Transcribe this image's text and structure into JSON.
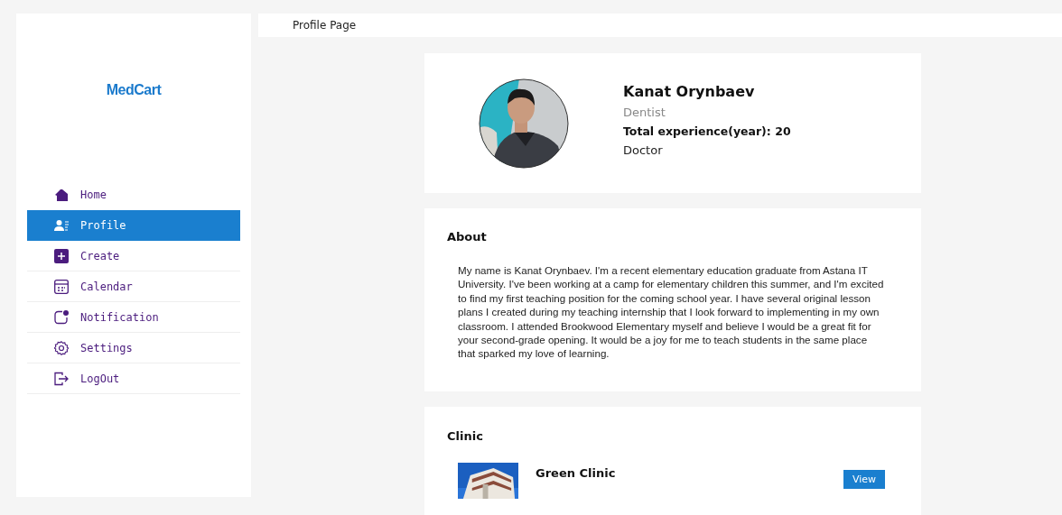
{
  "sidebar": {
    "logo": "MedCart",
    "items": [
      {
        "label": "Home",
        "selected": false
      },
      {
        "label": "Profile",
        "selected": true
      },
      {
        "label": "Create",
        "selected": false
      },
      {
        "label": "Calendar",
        "selected": false
      },
      {
        "label": "Notification",
        "selected": false
      },
      {
        "label": "Settings",
        "selected": false
      },
      {
        "label": "LogOut",
        "selected": false
      }
    ]
  },
  "header": {
    "title": "Profile Page"
  },
  "profile": {
    "name": "Kanat Orynbaev",
    "specialty": "Dentist",
    "experience": "Total experience(year): 20",
    "role": "Doctor"
  },
  "about": {
    "title": "About",
    "text": "My name is Kanat Orynbaev. I'm a recent elementary education graduate from Astana IT University. I've been working at a camp for elementary children this summer, and I'm excited to find my first teaching position for the coming school year. I have several original lesson plans I created during my teaching internship that I look forward to implementing in my own classroom. I attended Brookwood Elementary myself and believe I would be a great fit for your second-grade opening. It would be a joy for me to teach students in the same place that sparked my love of learning."
  },
  "clinic": {
    "title": "Clinic",
    "items": [
      {
        "name": "Green Clinic",
        "button": "View"
      }
    ]
  }
}
